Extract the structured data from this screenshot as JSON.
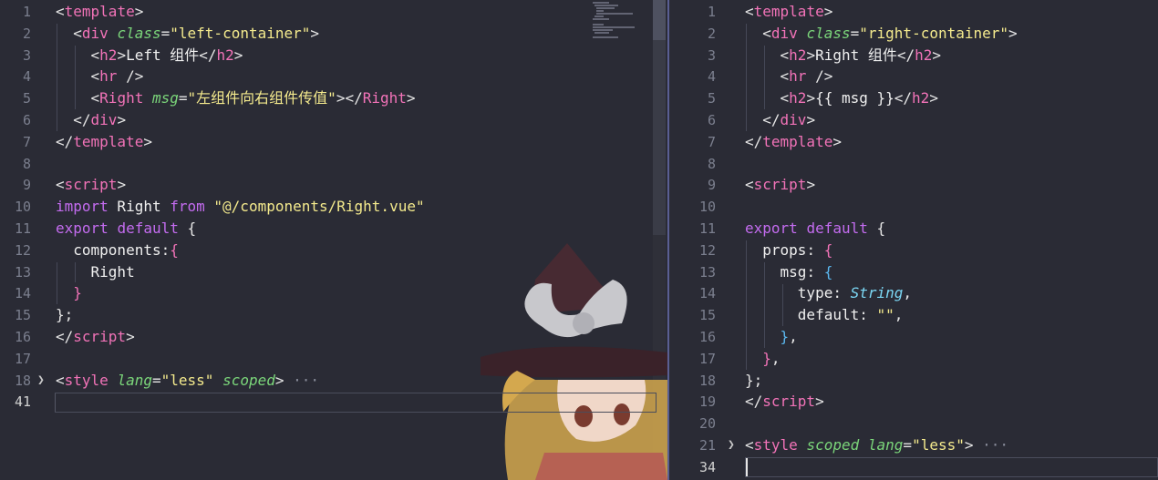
{
  "left_editor": {
    "lines": [
      {
        "n": "1",
        "tokens": [
          [
            "t-punct",
            "<"
          ],
          [
            "t-tag",
            "template"
          ],
          [
            "t-punct",
            ">"
          ]
        ]
      },
      {
        "n": "2",
        "tokens": [
          [
            "t-punct",
            "  <"
          ],
          [
            "t-tag",
            "div"
          ],
          [
            "t-punct",
            " "
          ],
          [
            "t-attr",
            "class"
          ],
          [
            "t-punct",
            "="
          ],
          [
            "t-str",
            "\"left-container\""
          ],
          [
            "t-punct",
            ">"
          ]
        ]
      },
      {
        "n": "3",
        "tokens": [
          [
            "t-punct",
            "    <"
          ],
          [
            "t-tag",
            "h2"
          ],
          [
            "t-punct",
            ">"
          ],
          [
            "t-plain",
            "Left 组件"
          ],
          [
            "t-punct",
            "</"
          ],
          [
            "t-tag",
            "h2"
          ],
          [
            "t-punct",
            ">"
          ]
        ]
      },
      {
        "n": "4",
        "tokens": [
          [
            "t-punct",
            "    <"
          ],
          [
            "t-tag",
            "hr"
          ],
          [
            "t-punct",
            " />"
          ]
        ]
      },
      {
        "n": "5",
        "tokens": [
          [
            "t-punct",
            "    <"
          ],
          [
            "t-tag",
            "Right"
          ],
          [
            "t-punct",
            " "
          ],
          [
            "t-attr",
            "msg"
          ],
          [
            "t-punct",
            "="
          ],
          [
            "t-str",
            "\"左组件向右组件传值\""
          ],
          [
            "t-punct",
            "></"
          ],
          [
            "t-tag",
            "Right"
          ],
          [
            "t-punct",
            ">"
          ]
        ]
      },
      {
        "n": "6",
        "tokens": [
          [
            "t-punct",
            "  </"
          ],
          [
            "t-tag",
            "div"
          ],
          [
            "t-punct",
            ">"
          ]
        ]
      },
      {
        "n": "7",
        "tokens": [
          [
            "t-punct",
            "</"
          ],
          [
            "t-tag",
            "template"
          ],
          [
            "t-punct",
            ">"
          ]
        ]
      },
      {
        "n": "8",
        "tokens": []
      },
      {
        "n": "9",
        "tokens": [
          [
            "t-punct",
            "<"
          ],
          [
            "t-tag",
            "script"
          ],
          [
            "t-punct",
            ">"
          ]
        ]
      },
      {
        "n": "10",
        "tokens": [
          [
            "t-kw",
            "import"
          ],
          [
            "t-plain",
            " Right "
          ],
          [
            "t-kw",
            "from"
          ],
          [
            "t-punct",
            " "
          ],
          [
            "t-str",
            "\"@/components/Right.vue\""
          ]
        ]
      },
      {
        "n": "11",
        "tokens": [
          [
            "t-kw",
            "export"
          ],
          [
            "t-punct",
            " "
          ],
          [
            "t-kw",
            "default"
          ],
          [
            "t-punct",
            " {"
          ]
        ]
      },
      {
        "n": "12",
        "tokens": [
          [
            "t-plain",
            "  components"
          ],
          [
            "t-punct",
            ":"
          ],
          [
            "t-brace-pink",
            "{"
          ]
        ]
      },
      {
        "n": "13",
        "tokens": [
          [
            "t-plain",
            "    Right"
          ]
        ]
      },
      {
        "n": "14",
        "tokens": [
          [
            "t-brace-pink",
            "  }"
          ]
        ]
      },
      {
        "n": "15",
        "tokens": [
          [
            "t-punct",
            "};"
          ]
        ]
      },
      {
        "n": "16",
        "tokens": [
          [
            "t-punct",
            "</"
          ],
          [
            "t-tag",
            "script"
          ],
          [
            "t-punct",
            ">"
          ]
        ]
      },
      {
        "n": "17",
        "tokens": []
      },
      {
        "n": "18",
        "fold": true,
        "tokens": [
          [
            "t-punct",
            "<"
          ],
          [
            "t-tag",
            "style"
          ],
          [
            "t-punct",
            " "
          ],
          [
            "t-attr",
            "lang"
          ],
          [
            "t-punct",
            "="
          ],
          [
            "t-str",
            "\"less\""
          ],
          [
            "t-punct",
            " "
          ],
          [
            "t-attr",
            "scoped"
          ],
          [
            "t-punct",
            ">"
          ],
          [
            "t-ellipsis",
            " ···"
          ]
        ]
      },
      {
        "n": "41",
        "active": true,
        "tokens": []
      }
    ]
  },
  "right_editor": {
    "lines": [
      {
        "n": "1",
        "tokens": [
          [
            "t-punct",
            "<"
          ],
          [
            "t-tag",
            "template"
          ],
          [
            "t-punct",
            ">"
          ]
        ]
      },
      {
        "n": "2",
        "tokens": [
          [
            "t-punct",
            "  <"
          ],
          [
            "t-tag",
            "div"
          ],
          [
            "t-punct",
            " "
          ],
          [
            "t-attr",
            "class"
          ],
          [
            "t-punct",
            "="
          ],
          [
            "t-str",
            "\"right-container\""
          ],
          [
            "t-punct",
            ">"
          ]
        ]
      },
      {
        "n": "3",
        "tokens": [
          [
            "t-punct",
            "    <"
          ],
          [
            "t-tag",
            "h2"
          ],
          [
            "t-punct",
            ">"
          ],
          [
            "t-plain",
            "Right 组件"
          ],
          [
            "t-punct",
            "</"
          ],
          [
            "t-tag",
            "h2"
          ],
          [
            "t-punct",
            ">"
          ]
        ]
      },
      {
        "n": "4",
        "tokens": [
          [
            "t-punct",
            "    <"
          ],
          [
            "t-tag",
            "hr"
          ],
          [
            "t-punct",
            " />"
          ]
        ]
      },
      {
        "n": "5",
        "tokens": [
          [
            "t-punct",
            "    <"
          ],
          [
            "t-tag",
            "h2"
          ],
          [
            "t-punct",
            ">"
          ],
          [
            "t-plain",
            "{{ msg }}"
          ],
          [
            "t-punct",
            "</"
          ],
          [
            "t-tag",
            "h2"
          ],
          [
            "t-punct",
            ">"
          ]
        ]
      },
      {
        "n": "6",
        "tokens": [
          [
            "t-punct",
            "  </"
          ],
          [
            "t-tag",
            "div"
          ],
          [
            "t-punct",
            ">"
          ]
        ]
      },
      {
        "n": "7",
        "tokens": [
          [
            "t-punct",
            "</"
          ],
          [
            "t-tag",
            "template"
          ],
          [
            "t-punct",
            ">"
          ]
        ]
      },
      {
        "n": "8",
        "tokens": []
      },
      {
        "n": "9",
        "tokens": [
          [
            "t-punct",
            "<"
          ],
          [
            "t-tag",
            "script"
          ],
          [
            "t-punct",
            ">"
          ]
        ]
      },
      {
        "n": "10",
        "tokens": []
      },
      {
        "n": "11",
        "tokens": [
          [
            "t-kw",
            "export"
          ],
          [
            "t-punct",
            " "
          ],
          [
            "t-kw",
            "default"
          ],
          [
            "t-punct",
            " {"
          ]
        ]
      },
      {
        "n": "12",
        "tokens": [
          [
            "t-plain",
            "  props"
          ],
          [
            "t-punct",
            ": "
          ],
          [
            "t-brace-pink",
            "{"
          ]
        ]
      },
      {
        "n": "13",
        "tokens": [
          [
            "t-plain",
            "    msg"
          ],
          [
            "t-punct",
            ": "
          ],
          [
            "t-brace-blue",
            "{"
          ]
        ]
      },
      {
        "n": "14",
        "tokens": [
          [
            "t-plain",
            "      type"
          ],
          [
            "t-punct",
            ": "
          ],
          [
            "t-type",
            "String"
          ],
          [
            "t-punct",
            ","
          ]
        ]
      },
      {
        "n": "15",
        "tokens": [
          [
            "t-plain",
            "      default"
          ],
          [
            "t-punct",
            ": "
          ],
          [
            "t-str",
            "\"\""
          ],
          [
            "t-punct",
            ","
          ]
        ]
      },
      {
        "n": "16",
        "tokens": [
          [
            "t-brace-blue",
            "    }"
          ],
          [
            "t-punct",
            ","
          ]
        ]
      },
      {
        "n": "17",
        "tokens": [
          [
            "t-brace-pink",
            "  }"
          ],
          [
            "t-punct",
            ","
          ]
        ]
      },
      {
        "n": "18",
        "tokens": [
          [
            "t-punct",
            "};"
          ]
        ]
      },
      {
        "n": "19",
        "tokens": [
          [
            "t-punct",
            "</"
          ],
          [
            "t-tag",
            "script"
          ],
          [
            "t-punct",
            ">"
          ]
        ]
      },
      {
        "n": "20",
        "tokens": []
      },
      {
        "n": "21",
        "fold": true,
        "tokens": [
          [
            "t-punct",
            "<"
          ],
          [
            "t-tag",
            "style"
          ],
          [
            "t-punct",
            " "
          ],
          [
            "t-attr",
            "scoped"
          ],
          [
            "t-punct",
            " "
          ],
          [
            "t-attr",
            "lang"
          ],
          [
            "t-punct",
            "="
          ],
          [
            "t-str",
            "\"less\""
          ],
          [
            "t-punct",
            ">"
          ],
          [
            "t-ellipsis",
            " ···"
          ]
        ]
      },
      {
        "n": "34",
        "active": true,
        "tokens": []
      }
    ]
  },
  "icons": {
    "fold": "chevron-right-icon",
    "background": "mascot-wallpaper-image"
  },
  "colors": {
    "background": "#2a2b35",
    "tag": "#f273b8",
    "attribute": "#7bd67a",
    "string": "#f4ea8d",
    "keyword": "#c46cf0",
    "type": "#7cd8f5"
  }
}
